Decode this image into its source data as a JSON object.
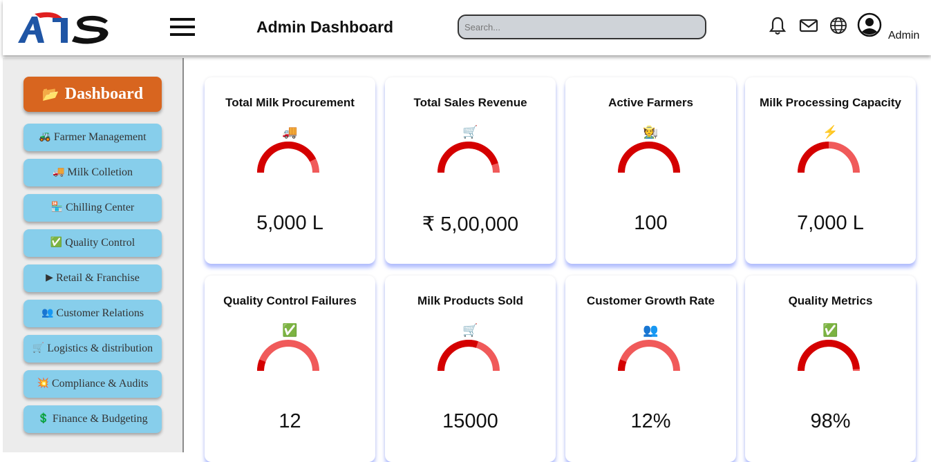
{
  "header": {
    "logo_text": "ATS",
    "title": "Admin Dashboard",
    "search_placeholder": "Search...",
    "user_label": "Admin",
    "icons": [
      "bell-icon",
      "mail-icon",
      "globe-icon",
      "user-icon"
    ]
  },
  "sidebar": {
    "dashboard": {
      "icon": "📂",
      "label": "Dashboard"
    },
    "items": [
      {
        "icon": "🚜",
        "label": "Farmer Management"
      },
      {
        "icon": "🚚",
        "label": "Milk Colletion"
      },
      {
        "icon": "🏪",
        "label": "Chilling Center"
      },
      {
        "icon": "✅",
        "label": "Quality Control"
      },
      {
        "icon": "▶",
        "label": "Retail & Franchise"
      },
      {
        "icon": "👥",
        "label": "Customer Relations"
      },
      {
        "icon": "🛒",
        "label": "Logistics & distribution"
      },
      {
        "icon": "💥",
        "label": "Compliance & Audits"
      },
      {
        "icon": "💲",
        "label": "Finance & Budgeting"
      }
    ]
  },
  "cards": [
    {
      "title": "Total Milk Procurement",
      "icon": "🚚",
      "value": "5,000 L",
      "gauge_fill": 0.85
    },
    {
      "title": "Total Sales Revenue",
      "icon": "🛒",
      "value": "₹ 5,00,000",
      "gauge_fill": 0.9
    },
    {
      "title": "Active Farmers",
      "icon": "🧑‍🌾",
      "value": "100",
      "gauge_fill": 1.0
    },
    {
      "title": "Milk Processing Capacity",
      "icon": "⚡",
      "value": "7,000 L",
      "gauge_fill": 0.5
    },
    {
      "title": "Quality Control Failures",
      "icon": "✅",
      "value": "12",
      "gauge_fill": 0.12
    },
    {
      "title": "Milk Products Sold",
      "icon": "🛒",
      "value": "15000",
      "gauge_fill": 0.6
    },
    {
      "title": "Customer Growth Rate",
      "icon": "👥",
      "value": "12%",
      "gauge_fill": 0.12
    },
    {
      "title": "Quality Metrics",
      "icon": "✅",
      "value": "98%",
      "gauge_fill": 0.98
    }
  ],
  "colors": {
    "gauge_fill": "#d40000",
    "gauge_track": "#f05a5a",
    "dashboard_button": "#d8651f",
    "nav_button": "#87ceeb"
  }
}
